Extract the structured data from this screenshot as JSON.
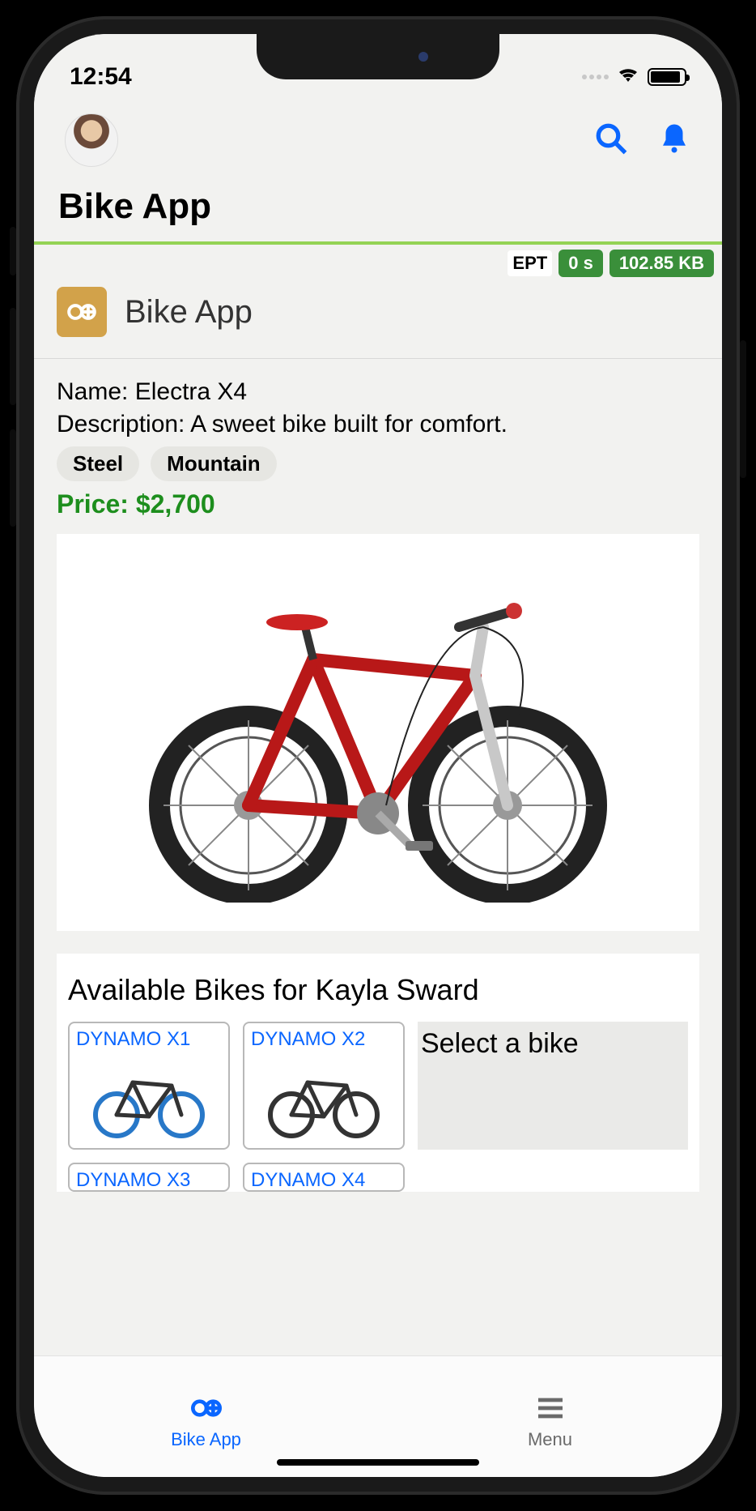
{
  "status": {
    "time": "12:54"
  },
  "header": {
    "app_title": "Bike App"
  },
  "perf": {
    "label": "EPT",
    "time": "0 s",
    "size": "102.85 KB"
  },
  "section": {
    "title": "Bike App"
  },
  "bike": {
    "name_label": "Name: ",
    "name": "Electra X4",
    "desc_label": "Description: ",
    "desc": "A sweet bike built for comfort.",
    "chip1": "Steel",
    "chip2": "Mountain",
    "price": "Price: $2,700"
  },
  "available": {
    "title": "Available Bikes for Kayla Sward",
    "select_msg": "Select a bike",
    "cards": {
      "c1": "DYNAMO X1",
      "c2": "DYNAMO X2",
      "c3": "DYNAMO X3",
      "c4": "DYNAMO X4"
    }
  },
  "tabs": {
    "t1": "Bike App",
    "t2": "Menu"
  }
}
